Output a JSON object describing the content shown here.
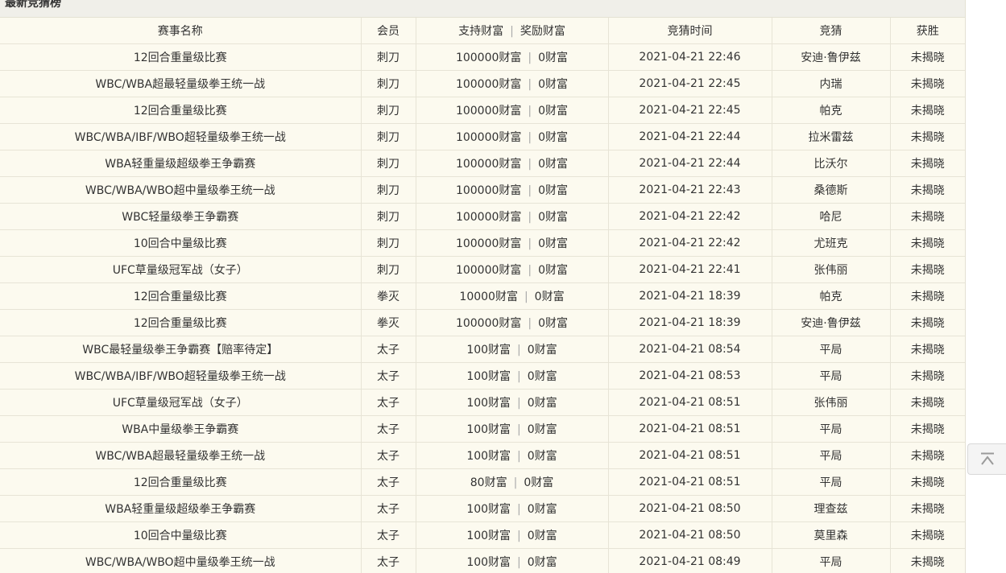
{
  "panel": {
    "title": "最新竞猜榜"
  },
  "table": {
    "headers": {
      "event": "赛事名称",
      "member": "会员",
      "support": "支持财富",
      "reward": "奖励财富",
      "time": "竞猜时间",
      "pick": "竞猜",
      "winner": "获胜"
    },
    "rows": [
      {
        "event": "12回合重量级比赛",
        "member": "刺刀",
        "support": "100000财富",
        "reward": "0财富",
        "time": "2021-04-21 22:46",
        "pick": "安迪·鲁伊兹",
        "winner": "未揭晓"
      },
      {
        "event": "WBC/WBA超最轻量级拳王统一战",
        "member": "刺刀",
        "support": "100000财富",
        "reward": "0财富",
        "time": "2021-04-21 22:45",
        "pick": "内瑞",
        "winner": "未揭晓"
      },
      {
        "event": "12回合重量级比赛",
        "member": "刺刀",
        "support": "100000财富",
        "reward": "0财富",
        "time": "2021-04-21 22:45",
        "pick": "帕克",
        "winner": "未揭晓"
      },
      {
        "event": "WBC/WBA/IBF/WBO超轻量级拳王统一战",
        "member": "刺刀",
        "support": "100000财富",
        "reward": "0财富",
        "time": "2021-04-21 22:44",
        "pick": "拉米雷兹",
        "winner": "未揭晓"
      },
      {
        "event": "WBA轻重量级超级拳王争霸赛",
        "member": "刺刀",
        "support": "100000财富",
        "reward": "0财富",
        "time": "2021-04-21 22:44",
        "pick": "比沃尔",
        "winner": "未揭晓"
      },
      {
        "event": "WBC/WBA/WBO超中量级拳王统一战",
        "member": "刺刀",
        "support": "100000财富",
        "reward": "0财富",
        "time": "2021-04-21 22:43",
        "pick": "桑德斯",
        "winner": "未揭晓"
      },
      {
        "event": "WBC轻量级拳王争霸赛",
        "member": "刺刀",
        "support": "100000财富",
        "reward": "0财富",
        "time": "2021-04-21 22:42",
        "pick": "哈尼",
        "winner": "未揭晓"
      },
      {
        "event": "10回合中量级比赛",
        "member": "刺刀",
        "support": "100000财富",
        "reward": "0财富",
        "time": "2021-04-21 22:42",
        "pick": "尤班克",
        "winner": "未揭晓"
      },
      {
        "event": "UFC草量级冠军战（女子）",
        "member": "刺刀",
        "support": "100000财富",
        "reward": "0财富",
        "time": "2021-04-21 22:41",
        "pick": "张伟丽",
        "winner": "未揭晓"
      },
      {
        "event": "12回合重量级比赛",
        "member": "拳灭",
        "support": "10000财富",
        "reward": "0财富",
        "time": "2021-04-21 18:39",
        "pick": "帕克",
        "winner": "未揭晓"
      },
      {
        "event": "12回合重量级比赛",
        "member": "拳灭",
        "support": "100000财富",
        "reward": "0财富",
        "time": "2021-04-21 18:39",
        "pick": "安迪·鲁伊兹",
        "winner": "未揭晓"
      },
      {
        "event": "WBC最轻量级拳王争霸赛【赔率待定】",
        "member": "太子",
        "support": "100财富",
        "reward": "0财富",
        "time": "2021-04-21 08:54",
        "pick": "平局",
        "winner": "未揭晓"
      },
      {
        "event": "WBC/WBA/IBF/WBO超轻量级拳王统一战",
        "member": "太子",
        "support": "100财富",
        "reward": "0财富",
        "time": "2021-04-21 08:53",
        "pick": "平局",
        "winner": "未揭晓"
      },
      {
        "event": "UFC草量级冠军战（女子）",
        "member": "太子",
        "support": "100财富",
        "reward": "0财富",
        "time": "2021-04-21 08:51",
        "pick": "张伟丽",
        "winner": "未揭晓"
      },
      {
        "event": "WBA中量级拳王争霸赛",
        "member": "太子",
        "support": "100财富",
        "reward": "0财富",
        "time": "2021-04-21 08:51",
        "pick": "平局",
        "winner": "未揭晓"
      },
      {
        "event": "WBC/WBA超最轻量级拳王统一战",
        "member": "太子",
        "support": "100财富",
        "reward": "0财富",
        "time": "2021-04-21 08:51",
        "pick": "平局",
        "winner": "未揭晓"
      },
      {
        "event": "12回合重量级比赛",
        "member": "太子",
        "support": "80财富",
        "reward": "0财富",
        "time": "2021-04-21 08:51",
        "pick": "平局",
        "winner": "未揭晓"
      },
      {
        "event": "WBA轻重量级超级拳王争霸赛",
        "member": "太子",
        "support": "100财富",
        "reward": "0财富",
        "time": "2021-04-21 08:50",
        "pick": "理查兹",
        "winner": "未揭晓"
      },
      {
        "event": "10回合中量级比赛",
        "member": "太子",
        "support": "100财富",
        "reward": "0财富",
        "time": "2021-04-21 08:50",
        "pick": "莫里森",
        "winner": "未揭晓"
      },
      {
        "event": "WBC/WBA/WBO超中量级拳王统一战",
        "member": "太子",
        "support": "100财富",
        "reward": "0财富",
        "time": "2021-04-21 08:49",
        "pick": "平局",
        "winner": "未揭晓"
      }
    ]
  },
  "back_to_top": {
    "icon": "back-to-top-icon"
  }
}
